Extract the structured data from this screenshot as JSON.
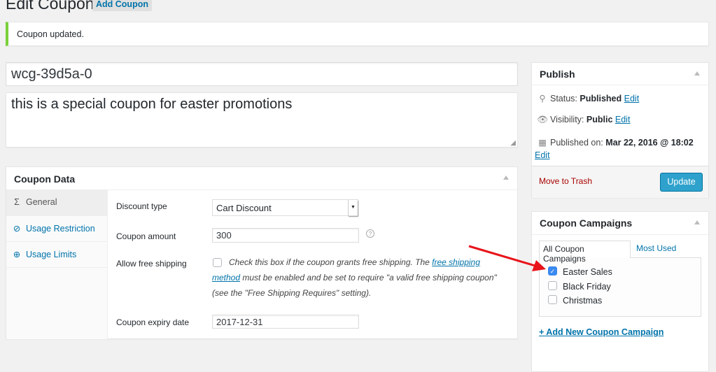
{
  "page": {
    "title": "Edit Coupon",
    "add_button": "Add Coupon"
  },
  "notice": {
    "text": "Coupon updated.",
    "color": "#7ad03a"
  },
  "coupon": {
    "code": "wcg-39d5a-0",
    "description": "this is a special coupon for easter promotions"
  },
  "coupon_data": {
    "title": "Coupon Data",
    "tabs": [
      {
        "label": "General",
        "icon": "ticket-icon"
      },
      {
        "label": "Usage Restriction",
        "icon": "ban-icon"
      },
      {
        "label": "Usage Limits",
        "icon": "plus-circle-icon"
      }
    ],
    "fields": {
      "discount_type": {
        "label": "Discount type",
        "value": "Cart Discount"
      },
      "amount": {
        "label": "Coupon amount",
        "value": "300"
      },
      "free_shipping": {
        "label": "Allow free shipping",
        "checked": false,
        "desc_before": "Check this box if the coupon grants free shipping. The ",
        "desc_link": "free shipping method",
        "desc_after": " must be enabled and be set to require \"a valid free shipping coupon\" (see the \"Free Shipping Requires\" setting)."
      },
      "expiry": {
        "label": "Coupon expiry date",
        "value": "2017-12-31"
      }
    }
  },
  "publish": {
    "title": "Publish",
    "status_label": "Status:",
    "status": "Published",
    "visibility_label": "Visibility:",
    "visibility": "Public",
    "published_label": "Published on:",
    "published": "Mar 22, 2016 @ 18:02",
    "edit": "Edit",
    "trash": "Move to Trash",
    "update": "Update",
    "accent": "#2ea2cc"
  },
  "campaigns": {
    "title": "Coupon Campaigns",
    "tabs": [
      "All Coupon Campaigns",
      "Most Used"
    ],
    "items": [
      {
        "label": "Easter Sales",
        "checked": true
      },
      {
        "label": "Black Friday",
        "checked": false
      },
      {
        "label": "Christmas",
        "checked": false
      }
    ],
    "add_link": "+ Add New Coupon Campaign"
  }
}
